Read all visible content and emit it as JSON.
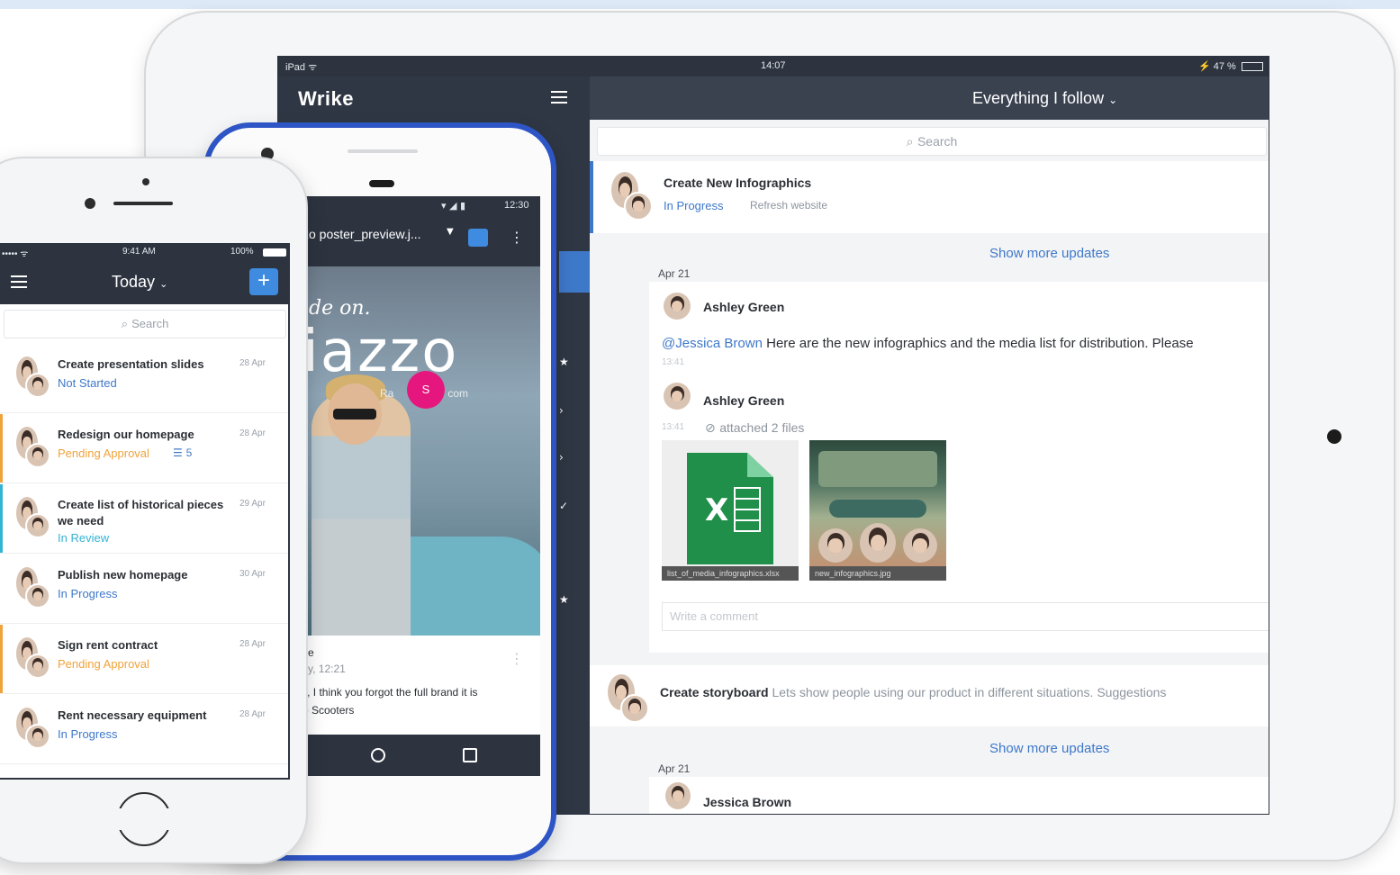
{
  "ipad": {
    "status": {
      "left": "iPad ᯤ",
      "time": "14:07",
      "right": "⚡ 47 %"
    },
    "brand": "Wrike",
    "header_title": "Everything I follow",
    "search_placeholder": "Search",
    "cards": [
      {
        "title": "Create New Infographics",
        "status": "In Progress",
        "subtitle": "Refresh website"
      }
    ],
    "show_more_label": "Show more updates",
    "date_1": "Apr 21",
    "comment_1": {
      "author": "Ashley Green",
      "mention": "@Jessica Brown",
      "text": " Here are the new infographics and the media list for distribution. Please",
      "time": "13:41"
    },
    "comment_2": {
      "author": "Ashley Green",
      "time": "13:41",
      "attachment_text": "attached 2 files"
    },
    "attachments": [
      {
        "caption": "list_of_media_infographics.xlsx",
        "icon": "excel-icon"
      },
      {
        "caption": "new_infographics.jpg",
        "icon": "image-thumbnail"
      }
    ],
    "comment_placeholder": "Write a comment",
    "card_2": {
      "title": "Create storyboard",
      "text": " Lets show people using our product in different situations. Suggestions"
    },
    "show_more_label_2": "Show more updates",
    "date_2": "Apr 21",
    "comment_3_author": "Jessica Brown"
  },
  "android": {
    "status_time": "12:30",
    "file_title": "zo poster_preview.j...",
    "poster_script": "ide on.",
    "poster_title": "iazzo",
    "poster_small_text": "Ra                  com",
    "pink_badge": "S",
    "comment_name": "e",
    "comment_time": "y, 12:21",
    "comment_text_1": "y, I think you forgot the full brand it is",
    "comment_text_2": "o Scooters"
  },
  "iphone": {
    "status": {
      "left": "••••• ᯤ",
      "time": "9:41 AM",
      "right": "100%"
    },
    "header_title": "Today",
    "add_label": "+",
    "search_placeholder": "Search",
    "tasks": [
      {
        "title": "Create presentation slides",
        "status": "Not Started",
        "status_type": "not",
        "date": "28 Apr"
      },
      {
        "title": "Redesign our homepage",
        "status": "Pending Approval",
        "status_type": "pend",
        "date": "28 Apr",
        "comments": "5"
      },
      {
        "title": "Create list of historical pieces we need",
        "status": "In Review",
        "status_type": "rev",
        "date": "29 Apr"
      },
      {
        "title": "Publish new homepage",
        "status": "In Progress",
        "status_type": "prog",
        "date": "30 Apr"
      },
      {
        "title": "Sign rent contract",
        "status": "Pending Approval",
        "status_type": "pend",
        "date": "28 Apr"
      },
      {
        "title": "Rent necessary equipment",
        "status": "In Progress",
        "status_type": "prog",
        "date": "28 Apr"
      }
    ]
  },
  "colors": {
    "accent_blue": "#3e78c9",
    "dark_bar": "#2d3440",
    "android_frame": "#2e55c6",
    "pending": "#f0a33a",
    "review": "#34b3d4",
    "pink": "#e5177e"
  }
}
